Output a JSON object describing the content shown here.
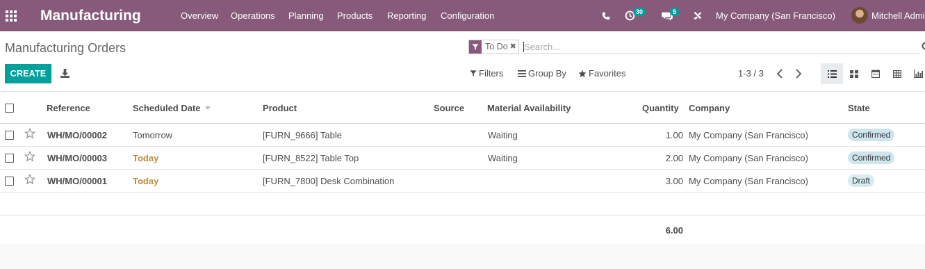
{
  "navbar": {
    "app_name": "Manufacturing",
    "menu": [
      "Overview",
      "Operations",
      "Planning",
      "Products",
      "Reporting",
      "Configuration"
    ],
    "activity_count": "30",
    "message_count": "5",
    "company": "My Company (San Francisco)",
    "user": "Mitchell Admin"
  },
  "control_panel": {
    "title": "Manufacturing Orders",
    "facet": "To Do",
    "search_placeholder": "Search...",
    "create_label": "CREATE",
    "filters_label": "Filters",
    "group_by_label": "Group By",
    "favorites_label": "Favorites",
    "pager": "1-3 / 3"
  },
  "table": {
    "columns": [
      "Reference",
      "Scheduled Date",
      "Product",
      "Source",
      "Material Availability",
      "Quantity",
      "Company",
      "State"
    ],
    "rows": [
      {
        "reference": "WH/MO/00002",
        "scheduled_date": "Tomorrow",
        "product": "[FURN_9666] Table",
        "source": "",
        "availability": "Waiting",
        "quantity": "1.00",
        "company": "My Company (San Francisco)",
        "state": "Confirmed"
      },
      {
        "reference": "WH/MO/00003",
        "scheduled_date": "Today",
        "product": "[FURN_8522] Table Top",
        "source": "",
        "availability": "Waiting",
        "quantity": "2.00",
        "company": "My Company (San Francisco)",
        "state": "Confirmed"
      },
      {
        "reference": "WH/MO/00001",
        "scheduled_date": "Today",
        "product": "[FURN_7800] Desk Combination",
        "source": "",
        "availability": "",
        "quantity": "3.00",
        "company": "My Company (San Francisco)",
        "state": "Draft"
      }
    ],
    "total_quantity": "6.00"
  },
  "colors": {
    "brand": "#875a7b",
    "primary_button": "#00a09d",
    "today_text": "#c08b3a",
    "badge_confirmed": "#cfe5ee",
    "badge_draft": "#d7ecee"
  },
  "icons": {
    "apps": "apps-grid-icon",
    "phone": "phone-icon",
    "activity": "clock-icon",
    "messages": "chat-icon",
    "debug": "tools-icon",
    "download": "download-icon",
    "filter": "filter-icon",
    "group_by": "list-icon",
    "favorites": "star-icon"
  }
}
